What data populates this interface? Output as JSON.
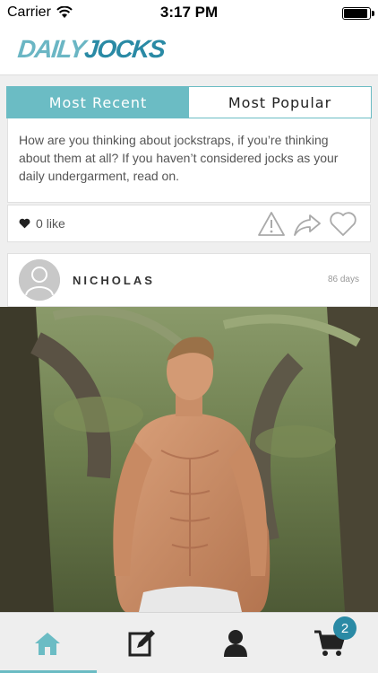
{
  "status_bar": {
    "carrier": "Carrier",
    "time": "3:17 PM",
    "battery_level": 1.0
  },
  "header": {
    "logo_part1": "DAILY",
    "logo_part2": "JOCKS",
    "brand_color": "#2a8aa5",
    "accent_color": "#6bbcc4"
  },
  "tabs": [
    {
      "label": "Most Recent",
      "active": true
    },
    {
      "label": "Most Popular",
      "active": false
    }
  ],
  "post": {
    "text": "How are you thinking about jockstraps, if you’re thinking about them at all? If you haven’t considered jocks as your daily undergarment, read on.",
    "like_count": "0",
    "like_label": "like",
    "icons": [
      "heart-icon",
      "warning-icon",
      "share-icon",
      "like-heart-outline-icon"
    ]
  },
  "author": {
    "name": "NICHOLAS",
    "age": "86 days"
  },
  "tabbar": {
    "items": [
      "home-icon",
      "compose-icon",
      "profile-icon",
      "cart-icon"
    ],
    "cart_badge": "2"
  }
}
